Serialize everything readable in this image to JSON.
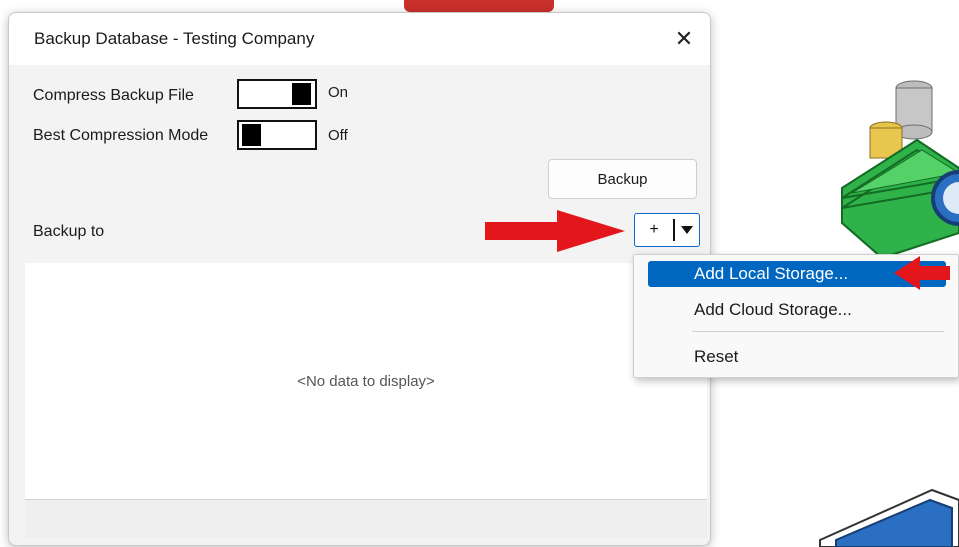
{
  "dialog": {
    "title": "Backup Database - Testing Company",
    "close_glyph": "✕"
  },
  "options": {
    "compress": {
      "label": "Compress Backup File",
      "state": "On",
      "enabled": true
    },
    "best_compression": {
      "label": "Best Compression Mode",
      "state": "Off",
      "enabled": false
    }
  },
  "backup_button": {
    "label": "Backup"
  },
  "backup_to": {
    "label": "Backup to",
    "add_label": "+",
    "dropdown_icon": "triangle-down-icon"
  },
  "grid": {
    "empty_text": "<No data to display>"
  },
  "menu": {
    "items": [
      {
        "label": "Add Local Storage...",
        "selected": true
      },
      {
        "label": "Add Cloud Storage...",
        "selected": false
      },
      {
        "label": "Reset",
        "selected": false
      }
    ]
  },
  "colors": {
    "accent": "#0067c0",
    "annotation": "#e3161c"
  }
}
